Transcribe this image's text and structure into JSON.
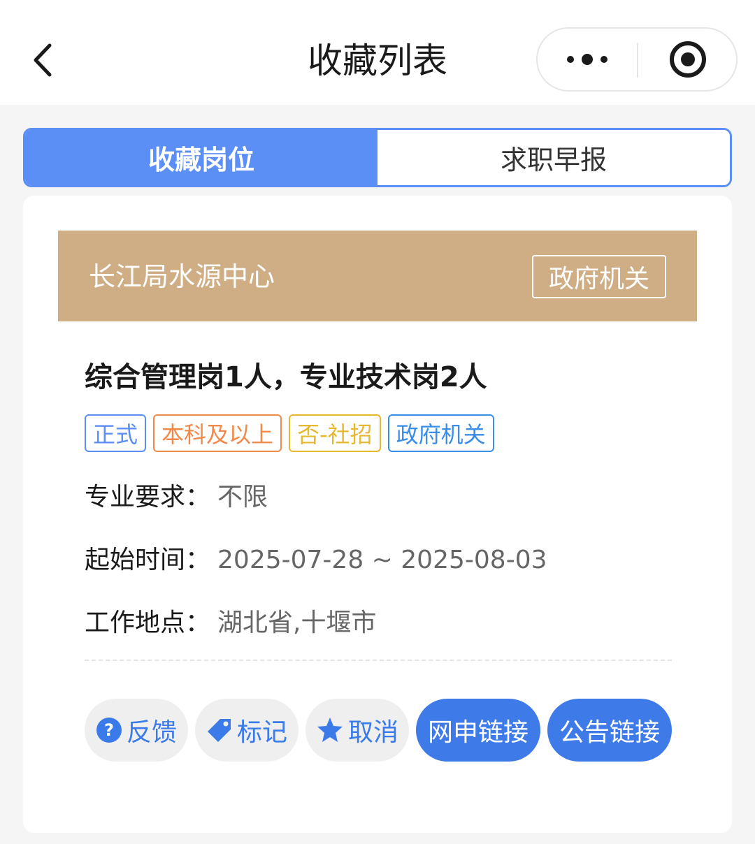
{
  "header": {
    "title": "收藏列表"
  },
  "tabs": [
    {
      "label": "收藏岗位",
      "active": true
    },
    {
      "label": "求职早报",
      "active": false
    }
  ],
  "job": {
    "org_name": "长江局水源中心",
    "org_type": "政府机关",
    "title": "综合管理岗1人，专业技术岗2人",
    "tags": [
      {
        "label": "正式",
        "color": "#5b8ff5"
      },
      {
        "label": "本科及以上",
        "color": "#f0894a"
      },
      {
        "label": "否-社招",
        "color": "#e6b830"
      },
      {
        "label": "政府机关",
        "color": "#3a8ee8"
      }
    ],
    "info": [
      {
        "label": "专业要求：",
        "value": "不限"
      },
      {
        "label": "起始时间：",
        "value": "2025-07-28 ~ 2025-08-03"
      },
      {
        "label": "工作地点：",
        "value": "湖北省,十堰市"
      }
    ]
  },
  "actions": {
    "feedback": {
      "label": "反馈",
      "icon": "question-circle-icon"
    },
    "mark": {
      "label": "标记",
      "icon": "tag-icon"
    },
    "cancel": {
      "label": "取消",
      "icon": "star-icon"
    },
    "apply_link": {
      "label": "网申链接"
    },
    "notice_link": {
      "label": "公告链接"
    }
  },
  "colors": {
    "accent": "#5b8ff5",
    "banner": "#cfae85",
    "primary_button": "#3e7be8"
  }
}
